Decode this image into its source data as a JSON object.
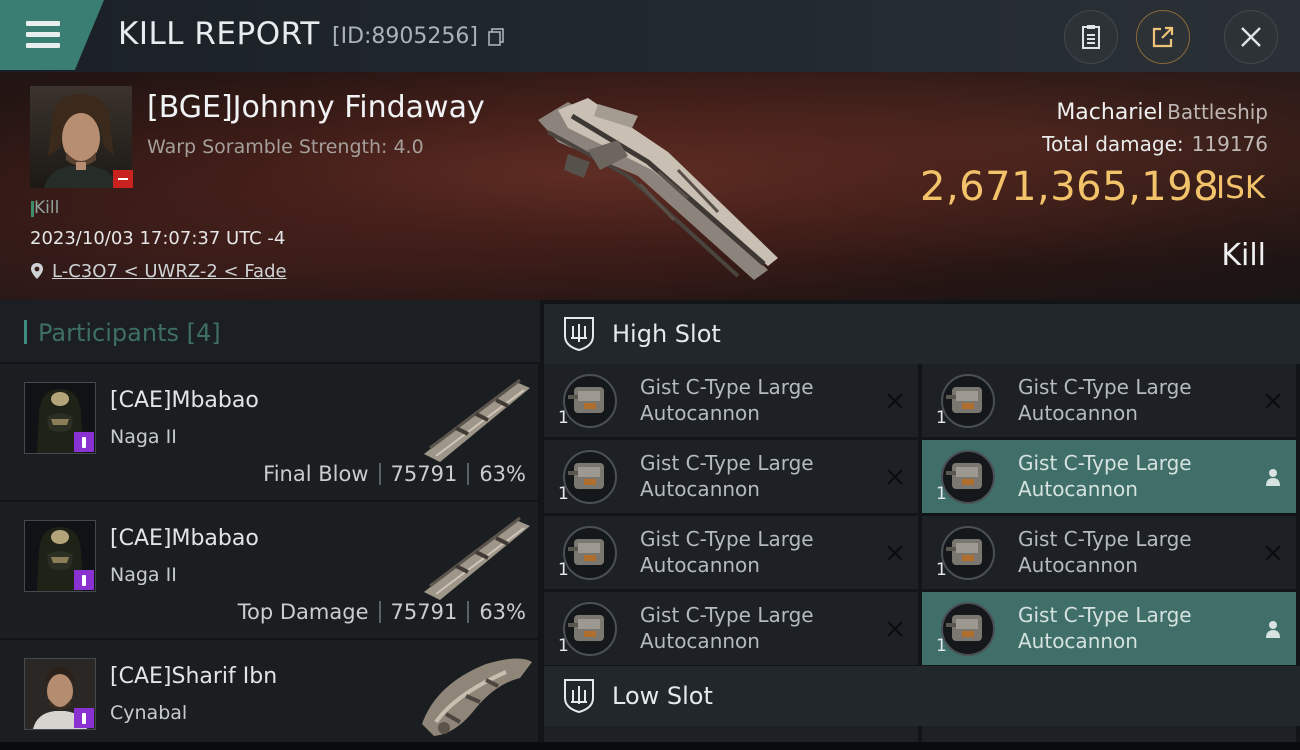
{
  "window": {
    "title": "KILL REPORT",
    "id_label": "[ID:8905256]"
  },
  "toolbar": {
    "menu_icon": "hamburger-icon",
    "clipboard_icon": "clipboard-icon",
    "share_icon": "share-icon",
    "close_icon": "close-icon"
  },
  "victim": {
    "name": "[BGE]Johnny Findaway",
    "subtitle": "Warp Soramble Strength: 4.0",
    "tag": "Kill",
    "datetime": "2023/10/03 17:07:37 UTC -4",
    "location": "L-C3O7 < UWRZ-2 < Fade",
    "ship_name": "Machariel",
    "ship_class": "Battleship",
    "total_damage_label": "Total damage:",
    "total_damage": "119176",
    "isk_value": "2,671,365,198",
    "isk_unit": "ISK",
    "result": "Kill"
  },
  "participants": {
    "header_label": "Participants",
    "count": "[4]",
    "rows": [
      {
        "name": "[CAE]Mbabao",
        "ship": "Naga II",
        "tag": "Final Blow",
        "damage": "75791",
        "percent": "63%"
      },
      {
        "name": "[CAE]Mbabao",
        "ship": "Naga II",
        "tag": "Top Damage",
        "damage": "75791",
        "percent": "63%"
      },
      {
        "name": "[CAE]Sharif Ibn",
        "ship": "Cynabal"
      }
    ]
  },
  "slots": {
    "high": {
      "title": "High Slot",
      "modules": [
        {
          "line1": "Gist C-Type Large",
          "line2": "Autocannon",
          "qty": "1",
          "state": "destroyed"
        },
        {
          "line1": "Gist C-Type Large",
          "line2": "Autocannon",
          "qty": "1",
          "state": "destroyed"
        },
        {
          "line1": "Gist C-Type Large",
          "line2": "Autocannon",
          "qty": "1",
          "state": "destroyed"
        },
        {
          "line1": "Gist C-Type Large",
          "line2": "Autocannon",
          "qty": "1",
          "state": "dropped"
        },
        {
          "line1": "Gist C-Type Large",
          "line2": "Autocannon",
          "qty": "1",
          "state": "destroyed"
        },
        {
          "line1": "Gist C-Type Large",
          "line2": "Autocannon",
          "qty": "1",
          "state": "destroyed"
        },
        {
          "line1": "Gist C-Type Large",
          "line2": "Autocannon",
          "qty": "1",
          "state": "destroyed"
        },
        {
          "line1": "Gist C-Type Large",
          "line2": "Autocannon",
          "qty": "1",
          "state": "dropped"
        }
      ]
    },
    "low": {
      "title": "Low Slot"
    }
  },
  "colors": {
    "accent": "#3a7d72",
    "isk": "#f2c36a",
    "dropped_row": "#3f6f68",
    "role_badge": "#8a32d1",
    "minus_badge": "#c8231f"
  }
}
